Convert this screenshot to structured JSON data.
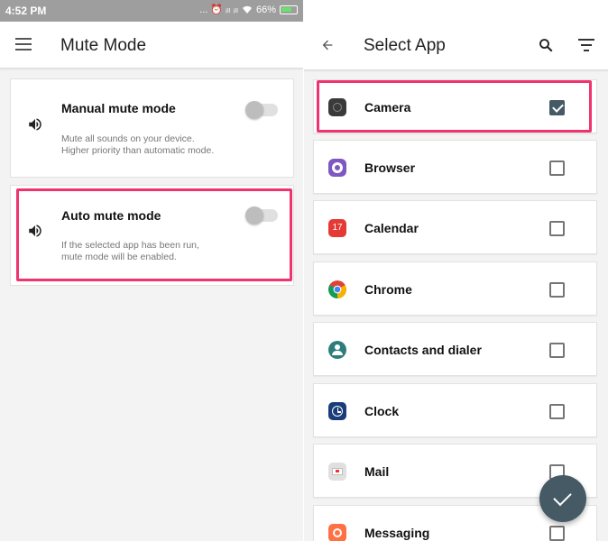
{
  "status_bar": {
    "time": "4:52 PM",
    "indicators": "... ⏰ ᵢₗₗ ᵢₗₗ",
    "battery": "66%"
  },
  "left": {
    "title": "Mute Mode",
    "menu_icon": "hamburger-menu-icon",
    "cards": [
      {
        "title": "Manual mute mode",
        "description": "Mute all sounds on your device.\nHigher priority than automatic mode.",
        "enabled": false,
        "icon": "speaker-icon"
      },
      {
        "title": "Auto mute mode",
        "description": "If the selected app has been run,\nmute mode will be enabled.",
        "enabled": false,
        "icon": "speaker-icon"
      }
    ]
  },
  "right": {
    "title": "Select App",
    "back_icon": "back-arrow-icon",
    "search_icon": "search-icon",
    "filter_icon": "filter-icon",
    "apps": [
      {
        "name": "Camera",
        "checked": true,
        "icon": "camera-icon",
        "color": "#3a3a3a"
      },
      {
        "name": "Browser",
        "checked": false,
        "icon": "browser-icon",
        "color": "#7e57c2"
      },
      {
        "name": "Calendar",
        "checked": false,
        "icon": "calendar-icon",
        "color": "#e53935",
        "icon_text": "17"
      },
      {
        "name": "Chrome",
        "checked": false,
        "icon": "chrome-icon",
        "color": "#4caf50"
      },
      {
        "name": "Contacts and dialer",
        "checked": false,
        "icon": "contacts-icon",
        "color": "#2e7d7d"
      },
      {
        "name": "Clock",
        "checked": false,
        "icon": "clock-icon",
        "color": "#1a3d7a"
      },
      {
        "name": "Mail",
        "checked": false,
        "icon": "mail-icon",
        "color": "#e0e0e0"
      },
      {
        "name": "Messaging",
        "checked": false,
        "icon": "messaging-icon",
        "color": "#ff7043"
      }
    ],
    "fab_icon": "confirm-check-icon"
  },
  "colors": {
    "highlight": "#f0336f",
    "accent": "#455a64",
    "toggle_off": "#bdbdbd"
  }
}
